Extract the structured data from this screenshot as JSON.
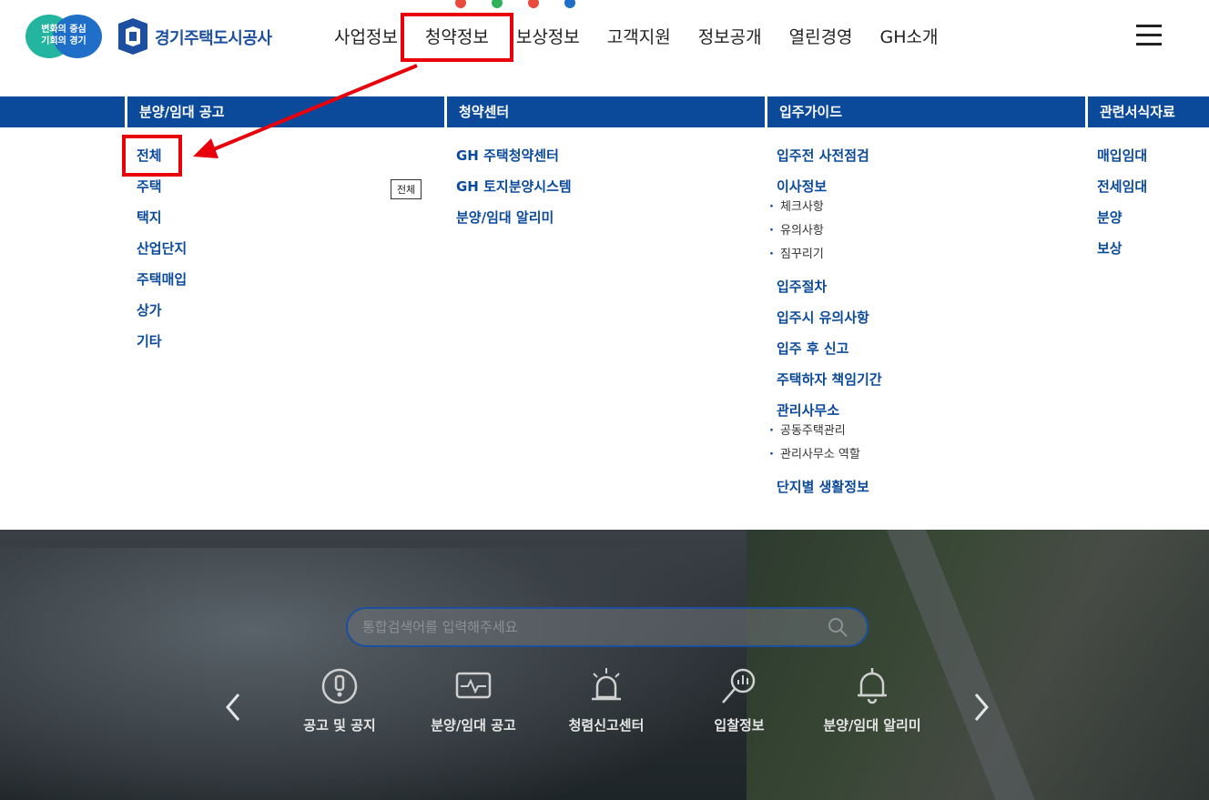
{
  "header": {
    "badge_line1": "변화의 중심",
    "badge_line2": "기회의 경기",
    "org_name": "경기주택도시공사",
    "nav": [
      {
        "label": "사업정보"
      },
      {
        "label": "청약정보"
      },
      {
        "label": "보상정보"
      },
      {
        "label": "고객지원"
      },
      {
        "label": "정보공개"
      },
      {
        "label": "열린경영"
      },
      {
        "label": "GH소개"
      }
    ],
    "active_nav": "청약정보"
  },
  "mega": {
    "col1": {
      "title": "분양/임대 공고",
      "items": [
        "전체",
        "주택",
        "택지",
        "산업단지",
        "주택매입",
        "상가",
        "기타"
      ]
    },
    "tooltip": "전체",
    "col2": {
      "title": "청약센터",
      "items": [
        "GH 주택청약센터",
        "GH 토지분양시스템",
        "분양/임대 알리미"
      ]
    },
    "col3": {
      "title": "입주가이드",
      "items": [
        {
          "label": "입주전 사전점검",
          "sub": []
        },
        {
          "label": "이사정보",
          "sub": [
            "체크사항",
            "유의사항",
            "짐꾸리기"
          ]
        },
        {
          "label": "입주절차",
          "sub": []
        },
        {
          "label": "입주시 유의사항",
          "sub": []
        },
        {
          "label": "입주 후 신고",
          "sub": []
        },
        {
          "label": "주택하자 책임기간",
          "sub": []
        },
        {
          "label": "관리사무소",
          "sub": [
            "공동주택관리",
            "관리사무소 역할"
          ]
        },
        {
          "label": "단지별 생활정보",
          "sub": []
        }
      ]
    },
    "col4": {
      "title": "관련서식자료",
      "items": [
        "매입임대",
        "전세임대",
        "분양",
        "보상"
      ]
    }
  },
  "hero": {
    "search_placeholder": "통합검색어를 입력해주세요",
    "quick_links": [
      {
        "label": "공고 및 공지",
        "icon": "exclamation-icon"
      },
      {
        "label": "분양/임대 공고",
        "icon": "monitor-pulse-icon"
      },
      {
        "label": "청렴신고센터",
        "icon": "siren-icon"
      },
      {
        "label": "입찰정보",
        "icon": "search-chart-icon"
      },
      {
        "label": "분양/임대 알리미",
        "icon": "bell-icon"
      }
    ]
  },
  "colors": {
    "brand_blue": "#0b4a9b",
    "highlight_red": "#e8000b"
  }
}
